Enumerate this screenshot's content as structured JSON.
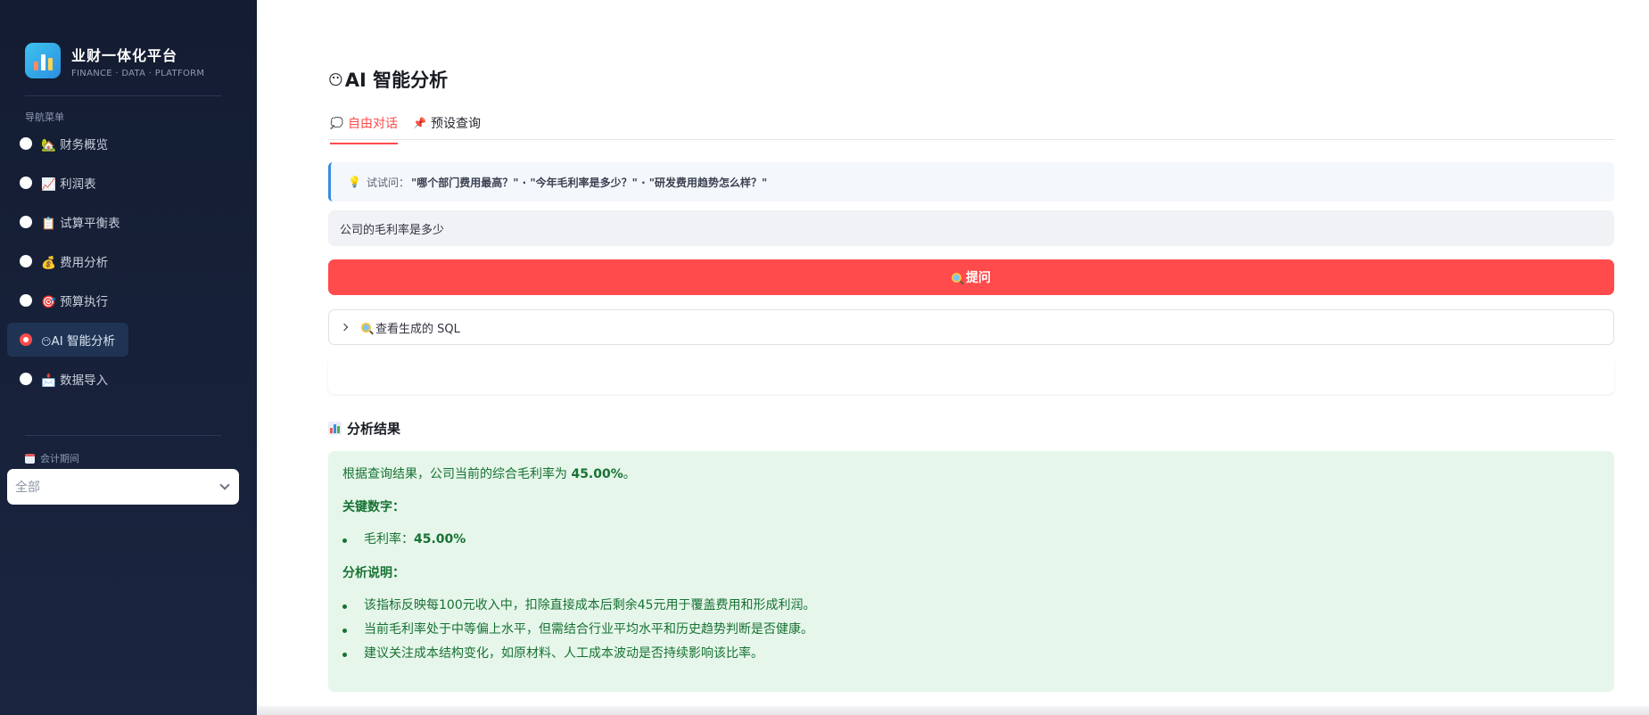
{
  "sidebar": {
    "brand_title": "业财一体化平台",
    "brand_subtitle": "FINANCE · DATA · PLATFORM",
    "nav_heading": "导航菜单",
    "items": [
      {
        "label": "🏡 财务概览"
      },
      {
        "label": "📈 利润表"
      },
      {
        "label": "📋 试算平衡表"
      },
      {
        "label": "💰 费用分析"
      },
      {
        "label": "🎯 预算执行"
      },
      {
        "label": "AI 智能分析"
      },
      {
        "label": "📩 数据导入"
      }
    ],
    "period_label": "会计期间",
    "period_value": "全部"
  },
  "main": {
    "title": "AI 智能分析",
    "tabs": [
      {
        "label": "自由对话",
        "icon": "speech-bubble-icon"
      },
      {
        "label": "预设查询",
        "icon": "pin-icon"
      }
    ],
    "hint_prefix": "试试问：",
    "hint_examples": "\"哪个部门费用最高？\" · \"今年毛利率是多少？\" · \"研发费用趋势怎么样？\"",
    "question_value": "公司的毛利率是多少",
    "ask_label": "提问",
    "sql_expander_label": "查看生成的 SQL",
    "result_heading": "分析结果",
    "result": {
      "intro_text": "根据查询结果，公司当前的综合毛利率为 ",
      "intro_value": "45.00%",
      "intro_end": "。",
      "key_heading": "关键数字：",
      "key_items": [
        {
          "label": "毛利率：",
          "value": "45.00%"
        }
      ],
      "explain_heading": "分析说明：",
      "explain_items": [
        "该指标反映每100元收入中，扣除直接成本后剩余45元用于覆盖费用和形成利润。",
        "当前毛利率处于中等偏上水平，但需结合行业平均水平和历史趋势判断是否健康。",
        "建议关注成本结构变化，如原材料、人工成本波动是否持续影响该比率。"
      ]
    }
  },
  "colors": {
    "accent": "#ff4b4b",
    "sidebar_bg": "#131c31",
    "result_bg": "#e6f6ea",
    "result_text": "#177233",
    "hint_border": "#3a8dde"
  }
}
